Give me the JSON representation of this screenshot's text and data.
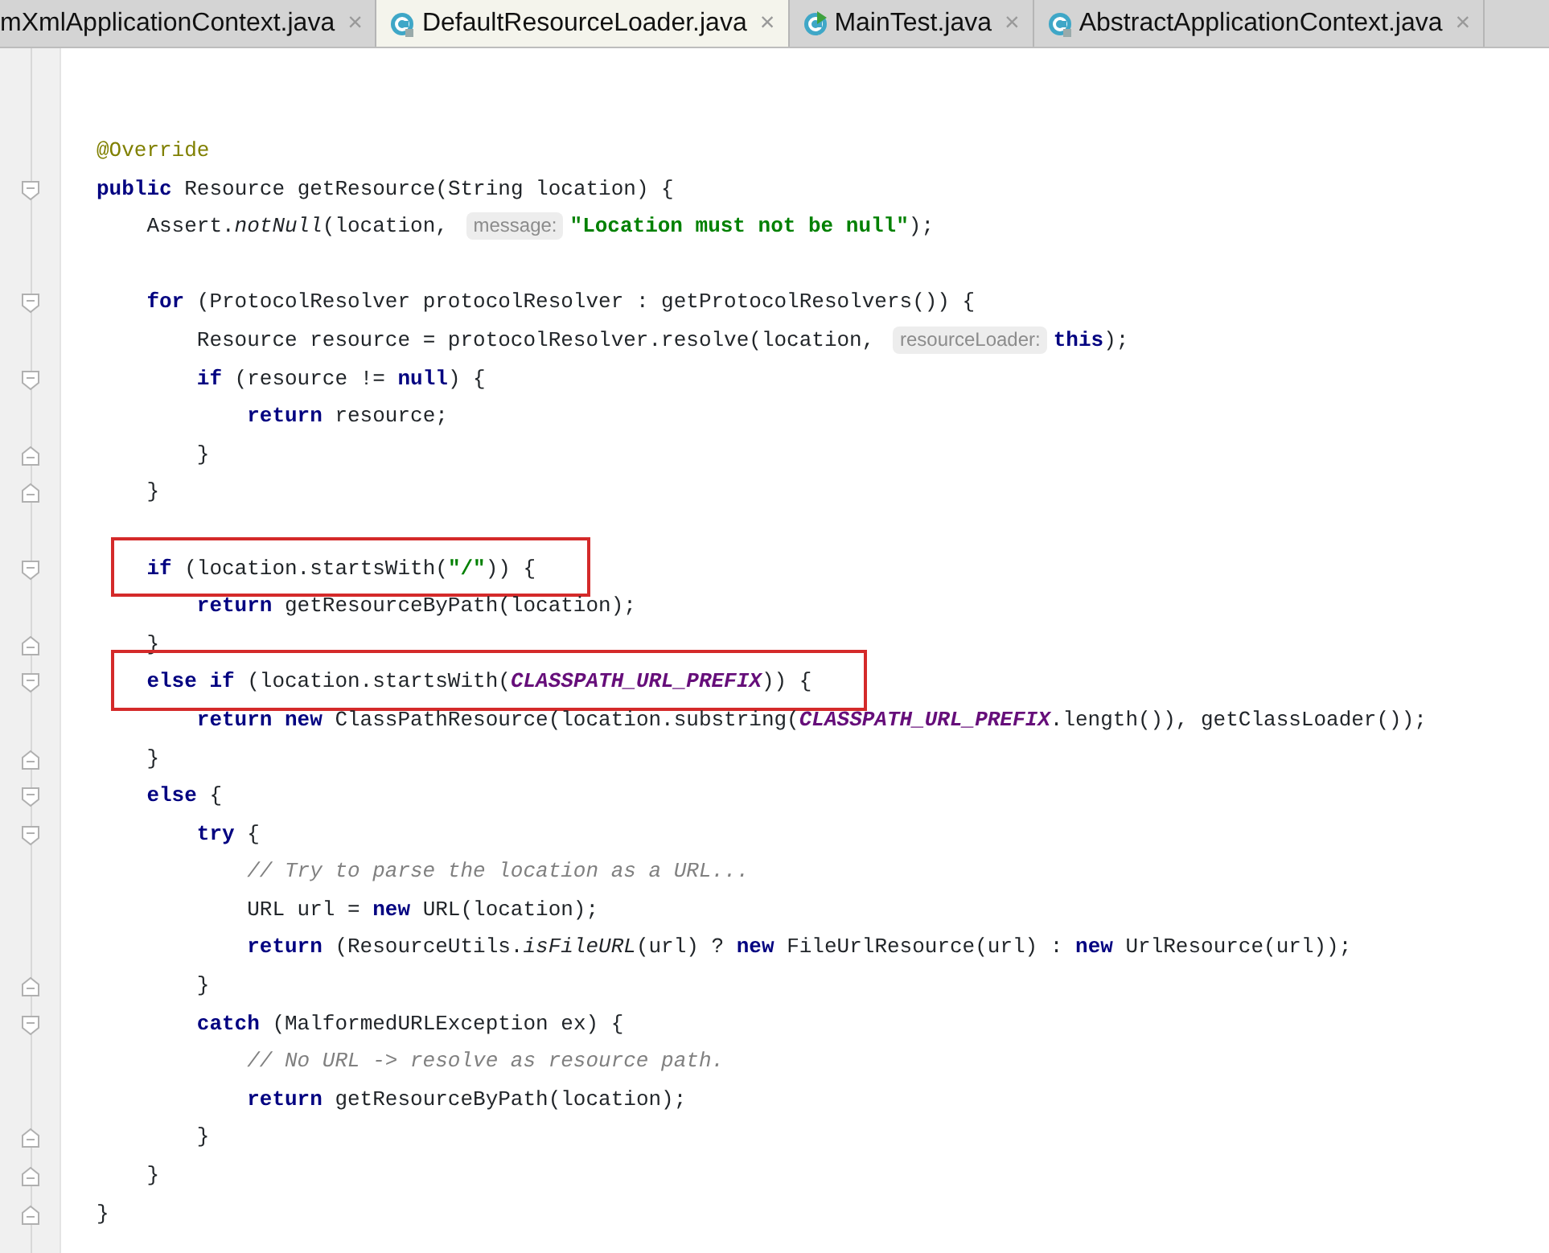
{
  "tabs": [
    {
      "label": "mXmlApplicationContext.java",
      "kind": "plain",
      "close": "×",
      "selected": false
    },
    {
      "label": "DefaultResourceLoader.java",
      "kind": "class",
      "close": "×",
      "selected": true
    },
    {
      "label": "MainTest.java",
      "kind": "runnable",
      "close": "×",
      "selected": false
    },
    {
      "label": "AbstractApplicationContext.java",
      "kind": "class",
      "close": "×",
      "selected": false
    }
  ],
  "editor": {
    "lines": [
      {
        "kind": "plain",
        "tokens": [
          {
            "kind": "annotation",
            "text": "@Override"
          }
        ]
      },
      {
        "kind": "fold_start",
        "tokens": [
          {
            "kind": "keyword",
            "text": "public"
          },
          {
            "kind": "code",
            "text": " Resource getResource(String location) {"
          }
        ],
        "children": [
          {
            "kind": "plain",
            "tokens": [
              {
                "kind": "code",
                "text": "Assert."
              },
              {
                "kind": "static_call",
                "text": "notNull"
              },
              {
                "kind": "code",
                "text": "(location, "
              },
              {
                "kind": "hint",
                "text": "message:"
              },
              {
                "kind": "string",
                "text": "\"Location must not be null\""
              },
              {
                "kind": "code",
                "text": ");"
              }
            ]
          },
          {
            "kind": "blank"
          },
          {
            "kind": "fold_start",
            "tokens": [
              {
                "kind": "keyword",
                "text": "for"
              },
              {
                "kind": "code",
                "text": " (ProtocolResolver protocolResolver : getProtocolResolvers()) {"
              }
            ],
            "children": [
              {
                "kind": "plain",
                "tokens": [
                  {
                    "kind": "code",
                    "text": "Resource resource = protocolResolver.resolve(location, "
                  },
                  {
                    "kind": "hint",
                    "text": "resourceLoader:"
                  },
                  {
                    "kind": "keyword",
                    "text": "this"
                  },
                  {
                    "kind": "code",
                    "text": ");"
                  }
                ]
              },
              {
                "kind": "fold_start",
                "tokens": [
                  {
                    "kind": "keyword",
                    "text": "if"
                  },
                  {
                    "kind": "code",
                    "text": " (resource != "
                  },
                  {
                    "kind": "keyword",
                    "text": "null"
                  },
                  {
                    "kind": "code",
                    "text": ") {"
                  }
                ],
                "children": [
                  {
                    "kind": "plain",
                    "tokens": [
                      {
                        "kind": "keyword",
                        "text": "return"
                      },
                      {
                        "kind": "code",
                        "text": " resource;"
                      }
                    ]
                  }
                ]
              },
              {
                "kind": "fold_end",
                "tokens": [
                  {
                    "kind": "code",
                    "text": "}"
                  }
                ]
              }
            ]
          },
          {
            "kind": "fold_end",
            "tokens": [
              {
                "kind": "code",
                "text": "}"
              }
            ]
          },
          {
            "kind": "blank"
          },
          {
            "kind": "fold_start",
            "boxed": true,
            "tokens": [
              {
                "kind": "keyword",
                "text": "if"
              },
              {
                "kind": "code",
                "text": " (location.startsWith("
              },
              {
                "kind": "string",
                "text": "\"/\""
              },
              {
                "kind": "code",
                "text": ")) {"
              }
            ],
            "children": [
              {
                "kind": "plain",
                "tokens": [
                  {
                    "kind": "keyword",
                    "text": "return"
                  },
                  {
                    "kind": "code",
                    "text": " getResourceByPath(location);"
                  }
                ]
              }
            ]
          },
          {
            "kind": "fold_end",
            "tokens": [
              {
                "kind": "code",
                "text": "}"
              }
            ]
          },
          {
            "kind": "fold_start",
            "boxed": true,
            "tokens": [
              {
                "kind": "keyword",
                "text": "else if"
              },
              {
                "kind": "code",
                "text": " (location.startsWith("
              },
              {
                "kind": "constant",
                "text": "CLASSPATH_URL_PREFIX"
              },
              {
                "kind": "code",
                "text": ")) {"
              }
            ],
            "children": [
              {
                "kind": "plain",
                "tokens": [
                  {
                    "kind": "keyword",
                    "text": "return new"
                  },
                  {
                    "kind": "code",
                    "text": " ClassPathResource(location.substring("
                  },
                  {
                    "kind": "constant",
                    "text": "CLASSPATH_URL_PREFIX"
                  },
                  {
                    "kind": "code",
                    "text": ".length()), getClassLoader());"
                  }
                ]
              }
            ]
          },
          {
            "kind": "fold_end",
            "tokens": [
              {
                "kind": "code",
                "text": "}"
              }
            ]
          },
          {
            "kind": "fold_start",
            "tokens": [
              {
                "kind": "keyword",
                "text": "else"
              },
              {
                "kind": "code",
                "text": " {"
              }
            ],
            "children": [
              {
                "kind": "fold_start",
                "tokens": [
                  {
                    "kind": "keyword",
                    "text": "try"
                  },
                  {
                    "kind": "code",
                    "text": " {"
                  }
                ],
                "children": [
                  {
                    "kind": "plain",
                    "tokens": [
                      {
                        "kind": "comment",
                        "text": "// Try to parse the location as a URL..."
                      }
                    ]
                  },
                  {
                    "kind": "plain",
                    "tokens": [
                      {
                        "kind": "code",
                        "text": "URL url = "
                      },
                      {
                        "kind": "keyword",
                        "text": "new"
                      },
                      {
                        "kind": "code",
                        "text": " URL(location);"
                      }
                    ]
                  },
                  {
                    "kind": "plain",
                    "tokens": [
                      {
                        "kind": "keyword",
                        "text": "return"
                      },
                      {
                        "kind": "code",
                        "text": " (ResourceUtils."
                      },
                      {
                        "kind": "static_call",
                        "text": "isFileURL"
                      },
                      {
                        "kind": "code",
                        "text": "(url) ? "
                      },
                      {
                        "kind": "keyword",
                        "text": "new"
                      },
                      {
                        "kind": "code",
                        "text": " FileUrlResource(url) : "
                      },
                      {
                        "kind": "keyword",
                        "text": "new"
                      },
                      {
                        "kind": "code",
                        "text": " UrlResource(url));"
                      }
                    ]
                  }
                ]
              },
              {
                "kind": "fold_end",
                "tokens": [
                  {
                    "kind": "code",
                    "text": "}"
                  }
                ]
              },
              {
                "kind": "fold_start",
                "tokens": [
                  {
                    "kind": "keyword",
                    "text": "catch"
                  },
                  {
                    "kind": "code",
                    "text": " (MalformedURLException ex) {"
                  }
                ],
                "children": [
                  {
                    "kind": "plain",
                    "tokens": [
                      {
                        "kind": "comment",
                        "text": "// No URL -> resolve as resource path."
                      }
                    ]
                  },
                  {
                    "kind": "plain",
                    "tokens": [
                      {
                        "kind": "keyword",
                        "text": "return"
                      },
                      {
                        "kind": "code",
                        "text": " getResourceByPath(location);"
                      }
                    ]
                  }
                ]
              },
              {
                "kind": "fold_end",
                "tokens": [
                  {
                    "kind": "code",
                    "text": "}"
                  }
                ]
              }
            ]
          },
          {
            "kind": "fold_end",
            "tokens": [
              {
                "kind": "code",
                "text": "}"
              }
            ]
          }
        ]
      },
      {
        "kind": "fold_end",
        "tokens": [
          {
            "kind": "code",
            "text": "}"
          }
        ]
      }
    ]
  }
}
